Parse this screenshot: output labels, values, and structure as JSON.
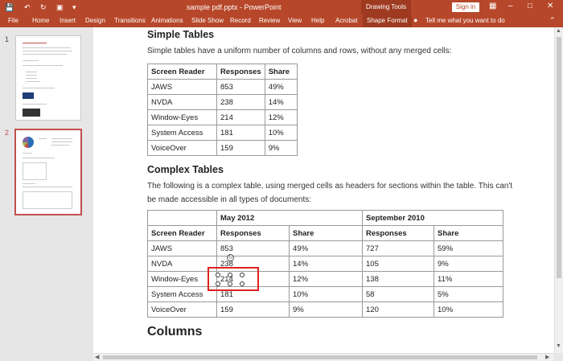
{
  "titlebar": {
    "title": "sample pdf.pptx  -  PowerPoint",
    "context_tab": "Drawing Tools",
    "signin": "Sign in"
  },
  "ribbon": {
    "tabs": [
      "File",
      "Home",
      "Insert",
      "Design",
      "Transitions",
      "Animations",
      "Slide Show",
      "Record",
      "Review",
      "View",
      "Help",
      "Acrobat",
      "Shape Format"
    ],
    "tell_me": "Tell me what you want to do"
  },
  "thumbnails": {
    "numbers": [
      "1",
      "2"
    ]
  },
  "doc": {
    "simple": {
      "heading": "Simple Tables",
      "para": "Simple tables have a uniform number of columns and rows, without any merged cells:",
      "headers": [
        "Screen Reader",
        "Responses",
        "Share"
      ],
      "rows": [
        [
          "JAWS",
          "853",
          "49%"
        ],
        [
          "NVDA",
          "238",
          "14%"
        ],
        [
          "Window-Eyes",
          "214",
          "12%"
        ],
        [
          "System Access",
          "181",
          "10%"
        ],
        [
          "VoiceOver",
          "159",
          "9%"
        ]
      ]
    },
    "complex": {
      "heading": "Complex Tables",
      "para_line1": "The following is a complex table, using merged cells as headers for sections within the table. This can't",
      "para_line2": "be made accessible in all types of documents:",
      "group_headers": [
        "May 2012",
        "September 2010"
      ],
      "headers": [
        "Screen Reader",
        "Responses",
        "Share",
        "Responses",
        "Share"
      ],
      "rows": [
        [
          "JAWS",
          "853",
          "49%",
          "727",
          "59%"
        ],
        [
          "NVDA",
          "238",
          "14%",
          "105",
          "9%"
        ],
        [
          "Window-Eyes",
          "214",
          "12%",
          "138",
          "11%"
        ],
        [
          "System Access",
          "181",
          "10%",
          "58",
          "5%"
        ],
        [
          "VoiceOver",
          "159",
          "9%",
          "120",
          "10%"
        ]
      ]
    },
    "columns_heading": "Columns"
  }
}
